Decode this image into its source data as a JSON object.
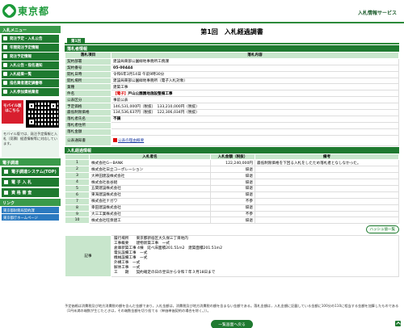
{
  "header": {
    "logo_text": "東京都",
    "service_name": "入札情報サービス"
  },
  "sidebar": {
    "menu_heading": "入札メニュー",
    "menu": [
      "発注予定・入札公告",
      "年間発注予定情報",
      "発注予定情報",
      "入札公告・指名通知",
      "入札結果一覧",
      "指名業者選定調書等",
      "入札参加資格業者"
    ],
    "mobile_button": "モバイル版はこちら",
    "mobile_note": "モバイル版では、発注予定情報と入札（見積）経過情報等に対応しています。",
    "systems_heading": "電子調達",
    "systems": [
      "電子調達システム(TOP)",
      "電 子 入 札",
      "資 格 審 査"
    ],
    "links_heading": "リンク",
    "links": [
      "東京都財務局契約課",
      "東京都庁ホームページ"
    ]
  },
  "main": {
    "title": "第1回　入札経過調書",
    "tab_label": "第1回",
    "section_info": "落札者情報",
    "table_headers": {
      "item": "落札項目",
      "content": "落札内容"
    },
    "info": [
      {
        "label": "契約部署",
        "value": "建設局東部公園緑地事務所工務課"
      },
      {
        "label": "契約番号",
        "value": "05-00444"
      },
      {
        "label": "開札日時",
        "value": "令和6年3月14日 午前9時30分"
      },
      {
        "label": "開札場所",
        "value": "建設局東部公園緑地事務所（電子入札対象）"
      },
      {
        "label": "業種",
        "value": "建築工事"
      },
      {
        "label": "件名",
        "prefix": "【電子】",
        "value": "戸山公園園地施設整備工事"
      },
      {
        "label": "公表区分",
        "value": "事前公表"
      },
      {
        "label": "予定価格",
        "value": "146,531,000円（税抜）　133,210,000円（税抜）"
      },
      {
        "label": "最低制限価格",
        "value": "134,536,637円（税抜）　122,306,034円（税抜）"
      },
      {
        "label": "落札者氏名",
        "value": "不調"
      },
      {
        "label": "落札者住所",
        "value": ""
      },
      {
        "label": "落札金額",
        "value": ""
      },
      {
        "label": "公表通知書",
        "value": "PDF",
        "link": "公表の理由概要"
      }
    ],
    "section_bidders": "入札経過情報",
    "bidder_headers": {
      "name": "入札者名",
      "amount": "入札金額（税抜）",
      "note": "備考"
    },
    "bidders": [
      {
        "no": "1",
        "name": "株式会社G－BANK",
        "amount": "122,240,000円",
        "note": "最低制限価格を下回る入札をしたため落札者となしなかった。"
      },
      {
        "no": "2",
        "name": "株式会社日立コーポレーション",
        "amount": "辞退",
        "note": ""
      },
      {
        "no": "3",
        "name": "大神田建設株式会社",
        "amount": "辞退",
        "note": ""
      },
      {
        "no": "4",
        "name": "株式会社長谷組",
        "amount": "辞退",
        "note": ""
      },
      {
        "no": "5",
        "name": "五関建設株式会社",
        "amount": "辞退",
        "note": ""
      },
      {
        "no": "6",
        "name": "東海建設株式会社",
        "amount": "辞退",
        "note": ""
      },
      {
        "no": "7",
        "name": "株式会社ナガワ",
        "amount": "不参",
        "note": ""
      },
      {
        "no": "8",
        "name": "幸田建設株式会社",
        "amount": "辞退",
        "note": ""
      },
      {
        "no": "9",
        "name": "大三工業株式会社",
        "amount": "不参",
        "note": ""
      },
      {
        "no": "10",
        "name": "株式会社旺衆建工",
        "amount": "辞退",
        "note": ""
      }
    ],
    "hatch_button": "ハッシュ値一覧",
    "remarks_label": "記事",
    "remarks": [
      "履行場所　　東京都新宿区大久保三丁目地内",
      "工事概要　　建物新築工事　一式",
      "倉庫新築工事 4棟　延べ床面積201.51m2　建築面積201.51m2",
      "電気設備工事　一式",
      "機械設備工事　一式",
      "外構工事　一式",
      "解体工事　一式",
      "工　　期　　契約確定の日の翌日から令和７年３月18日まで"
    ],
    "footnote": "予定価格は消費税及び地方消費税の額を含んだ金額であり，入札金額は，消費税及び地方消費税の額を含まない金額である。落札金額は，入札金額に記載している金額に100分の110に相当する金額を加算したものである（1円未満の端数が生じたときは，その端数金額を切り捨てる（単価単価契約の場合を除く。））。",
    "back_button": "一覧画面へ戻る"
  }
}
